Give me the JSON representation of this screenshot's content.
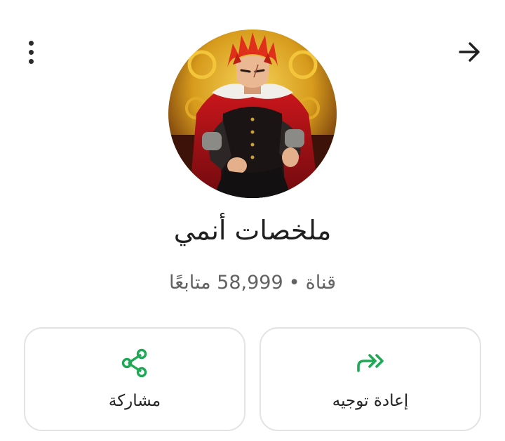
{
  "header": {
    "menu_icon": "more-vertical-icon",
    "back_icon": "arrow-right-icon"
  },
  "channel": {
    "name": "ملخصات أنمي",
    "type_label": "قناة",
    "separator": "•",
    "followers_text": "58,999 متابعًا",
    "avatar_description_icon": "channel-avatar"
  },
  "actions": {
    "share": {
      "label": "مشاركة",
      "icon": "share-icon"
    },
    "forward": {
      "label": "إعادة توجيه",
      "icon": "forward-icon"
    }
  },
  "colors": {
    "accent": "#1fa855",
    "border": "#e3e3e3",
    "text": "#1e1e1e",
    "muted": "#626262"
  }
}
